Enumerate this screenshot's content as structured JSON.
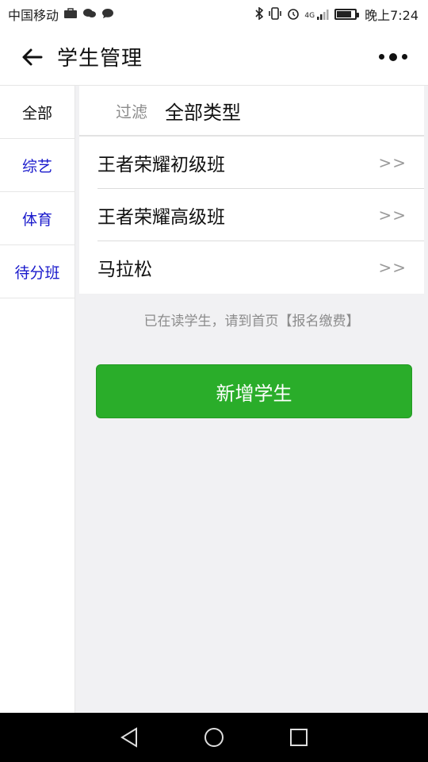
{
  "status_bar": {
    "carrier": "中国移动",
    "network": "4G",
    "time": "晚上7:24"
  },
  "header": {
    "title": "学生管理"
  },
  "sidebar": {
    "items": [
      {
        "label": "全部",
        "active": true
      },
      {
        "label": "综艺",
        "active": false
      },
      {
        "label": "体育",
        "active": false
      },
      {
        "label": "待分班",
        "active": false
      }
    ]
  },
  "filter": {
    "label": "过滤",
    "value": "全部类型"
  },
  "classes": [
    {
      "name": "王者荣耀初级班",
      "arrow": ">>"
    },
    {
      "name": "王者荣耀高级班",
      "arrow": ">>"
    },
    {
      "name": "马拉松",
      "arrow": ">>"
    }
  ],
  "hint": "已在读学生，请到首页【报名缴费】",
  "actions": {
    "add_student_label": "新增学生"
  },
  "colors": {
    "accent_green": "#2aad2a",
    "link_blue": "#1a1acc",
    "background": "#f1f1f3"
  }
}
